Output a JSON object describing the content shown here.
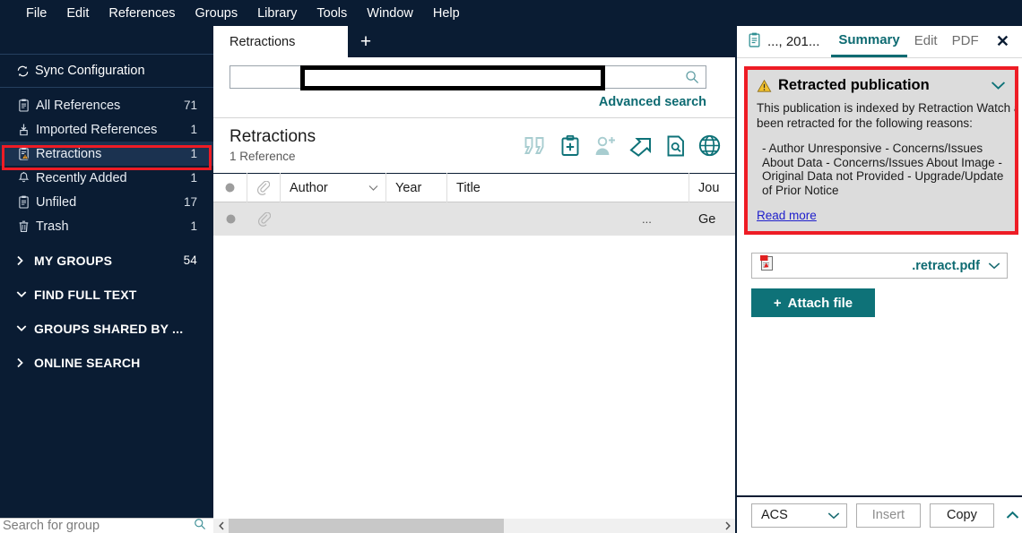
{
  "menubar": {
    "items": [
      {
        "label": "File"
      },
      {
        "label": "Edit"
      },
      {
        "label": "References"
      },
      {
        "label": "Groups"
      },
      {
        "label": "Library"
      },
      {
        "label": "Tools"
      },
      {
        "label": "Window"
      },
      {
        "label": "Help"
      }
    ]
  },
  "sidebar": {
    "sync_label": "Sync Configuration",
    "items": [
      {
        "label": "All References",
        "count": "71",
        "icon": "clipboard-icon",
        "selected": false
      },
      {
        "label": "Imported References",
        "count": "1",
        "icon": "import-icon",
        "selected": false
      },
      {
        "label": "Retractions",
        "count": "1",
        "icon": "clipboard-warning-icon",
        "selected": true
      },
      {
        "label": "Recently Added",
        "count": "1",
        "icon": "bell-icon",
        "selected": false
      },
      {
        "label": "Unfiled",
        "count": "17",
        "icon": "clipboard-icon",
        "selected": false
      },
      {
        "label": "Trash",
        "count": "1",
        "icon": "trash-icon",
        "selected": false
      }
    ],
    "groups": [
      {
        "label": "MY GROUPS",
        "count": "54",
        "state": "collapsed"
      },
      {
        "label": "FIND FULL TEXT",
        "count": "",
        "state": "expanded"
      },
      {
        "label": "GROUPS SHARED BY ...",
        "count": "",
        "state": "expanded"
      },
      {
        "label": "ONLINE SEARCH",
        "count": "",
        "state": "collapsed"
      }
    ],
    "footer_search_placeholder": "Search for group",
    "footer_search_value": ""
  },
  "center": {
    "tabs": [
      {
        "label": "Retractions",
        "active": true
      }
    ],
    "new_tab_label": "+",
    "search": {
      "value": "",
      "placeholder": "",
      "icon": "search-icon"
    },
    "advanced_search_label": "Advanced search",
    "list_title": "Retractions",
    "list_subtitle": "1 Reference",
    "toolbar_icons": [
      {
        "name": "quote-icon",
        "enabled": false
      },
      {
        "name": "clipboard-plus-icon",
        "enabled": true
      },
      {
        "name": "add-person-icon",
        "enabled": false
      },
      {
        "name": "share-arrow-icon",
        "enabled": true
      },
      {
        "name": "find-full-text-icon",
        "enabled": true
      },
      {
        "name": "online-search-globe-icon",
        "enabled": true
      }
    ],
    "columns": [
      {
        "label": "",
        "key": "dot"
      },
      {
        "label": "",
        "key": "clip"
      },
      {
        "label": "Author",
        "key": "author",
        "sorted": true
      },
      {
        "label": "Year",
        "key": "year"
      },
      {
        "label": "Title",
        "key": "title"
      },
      {
        "label": "Jou",
        "key": "journal"
      }
    ],
    "rows": [
      {
        "dot": "",
        "clip": "",
        "author": "",
        "year": "",
        "title": "",
        "redacted": true,
        "ellipsis": "...",
        "journal": "Ge"
      }
    ]
  },
  "right_panel": {
    "reference_name": "..., 201...",
    "reference_icon": "clipboard-icon",
    "tabs": [
      {
        "label": "Summary",
        "active": true
      },
      {
        "label": "Edit",
        "active": false
      },
      {
        "label": "PDF",
        "active": false
      }
    ],
    "close_label": "✕",
    "alert": {
      "icon": "warning-triangle-icon",
      "title": "Retracted publication",
      "collapse_icon": "chevron-down-icon",
      "body": "This publication is indexed by Retraction Watch and has\nbeen retracted for the following reasons:",
      "reasons": "- Author Unresponsive\n- Concerns/Issues About Data\n- Concerns/Issues About Image\n- Original Data not Provided\n- Upgrade/Update of Prior Notice",
      "link_label": "Read more"
    },
    "attachment": {
      "icon": "pdf-file-icon",
      "filename": ".retract.pdf",
      "chevron": "chevron-down-icon"
    },
    "attach_button_label": "Attach file",
    "attach_button_plus": "+",
    "footer": {
      "style_value": "ACS",
      "insert_label": "Insert",
      "copy_label": "Copy",
      "expand_icon": "chevron-up-icon"
    }
  },
  "colors": {
    "navy": "#0a1c33",
    "teal": "#0e6b72",
    "red_highlight": "#ee1c25",
    "alert_bg": "#dcdcdc",
    "row_bg": "#e3e3e3",
    "link_blue": "#2020cc"
  }
}
